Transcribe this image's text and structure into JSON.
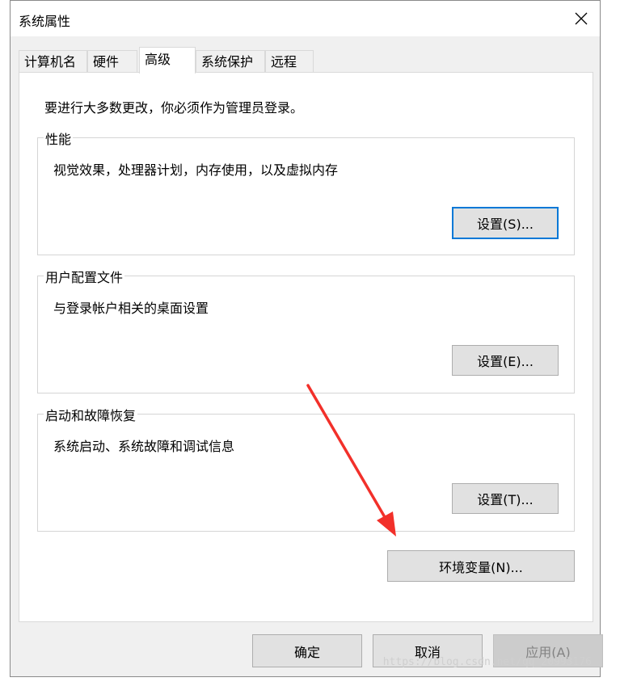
{
  "window": {
    "title": "系统属性"
  },
  "tabs": [
    {
      "label": "计算机名"
    },
    {
      "label": "硬件"
    },
    {
      "label": "高级"
    },
    {
      "label": "系统保护"
    },
    {
      "label": "远程"
    }
  ],
  "active_tab": "高级",
  "panel": {
    "intro": "要进行大多数更改，你必须作为管理员登录。",
    "groups": [
      {
        "title": "性能",
        "description": "视觉效果，处理器计划，内存使用，以及虚拟内存",
        "button": "设置(S)..."
      },
      {
        "title": "用户配置文件",
        "description": "与登录帐户相关的桌面设置",
        "button": "设置(E)..."
      },
      {
        "title": "启动和故障恢复",
        "description": "系统启动、系统故障和调试信息",
        "button": "设置(T)..."
      }
    ],
    "env_button": "环境变量(N)..."
  },
  "footer": {
    "ok": "确定",
    "cancel": "取消",
    "apply": "应用(A)"
  },
  "watermark": "https://blog.csdn.net/qq_20993176",
  "colors": {
    "annotation_arrow": "#f2302a",
    "focus_border": "#0078d7"
  }
}
